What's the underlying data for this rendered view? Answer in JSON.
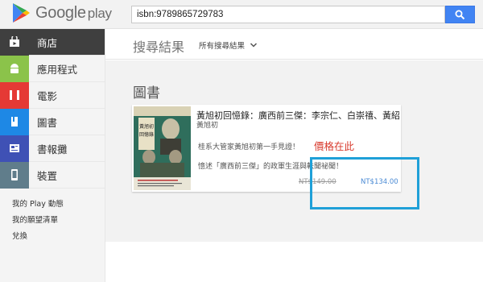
{
  "header": {
    "logo_text": "Google",
    "logo_suffix": "play",
    "search": {
      "value": "isbn:9789865729783",
      "placeholder": ""
    }
  },
  "sidebar": {
    "items": [
      {
        "label": "商店",
        "icon": "store-icon",
        "color": "#3f3f3f",
        "active": true
      },
      {
        "label": "應用程式",
        "icon": "android-icon",
        "color": "#8bc34a",
        "active": false
      },
      {
        "label": "電影",
        "icon": "film-icon",
        "color": "#e53935",
        "active": false
      },
      {
        "label": "圖書",
        "icon": "book-icon",
        "color": "#1e88e5",
        "active": false
      },
      {
        "label": "書報攤",
        "icon": "newsstand-icon",
        "color": "#3f51b5",
        "active": false
      },
      {
        "label": "裝置",
        "icon": "device-icon",
        "color": "#607d8b",
        "active": false
      }
    ],
    "links": [
      "我的 Play 動態",
      "我的願望清單",
      "兌換"
    ]
  },
  "main": {
    "title": "搜尋結果",
    "filter_label": "所有搜尋結果",
    "section_title": "圖書",
    "card": {
      "title": "黃旭初回憶錄：廣西前三傑：李宗仁、白崇禧、黃紹竑",
      "author": "黃旭初",
      "tagline": "桂系大管家黃旭初第一手見證！",
      "price_callout": "價格在此",
      "description": "憶述「廣西前三傑」的政軍生涯與軼聞祕聞！",
      "old_price": "NT$149.00",
      "new_price": "NT$134.00",
      "cover_title": "黃旭初回憶錄"
    }
  },
  "colors": {
    "accent": "#4184f3",
    "highlight_box": "#1fa0d8",
    "price_red": "#d83b2e"
  }
}
